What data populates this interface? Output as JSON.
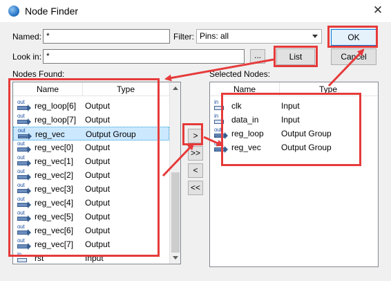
{
  "window": {
    "title": "Node Finder"
  },
  "form": {
    "named_label": "Named:",
    "named_value": "*",
    "filter_label": "Filter:",
    "filter_value": "Pins: all",
    "lookin_label": "Look in:",
    "lookin_value": "*",
    "browse_label": "..."
  },
  "buttons": {
    "ok": "OK",
    "list": "List",
    "cancel": "Cancel",
    "move_one": ">",
    "move_all": ">>",
    "remove_one": "<",
    "remove_all": "<<"
  },
  "nodes_found": {
    "heading": "Nodes Found:",
    "col_name": "Name",
    "col_type": "Type",
    "rows": [
      {
        "io": "out",
        "name": "reg_loop[6]",
        "type": "Output"
      },
      {
        "io": "out",
        "name": "reg_loop[7]",
        "type": "Output"
      },
      {
        "io": "out",
        "name": "reg_vec",
        "type": "Output Group",
        "selected": true
      },
      {
        "io": "out",
        "name": "reg_vec[0]",
        "type": "Output"
      },
      {
        "io": "out",
        "name": "reg_vec[1]",
        "type": "Output"
      },
      {
        "io": "out",
        "name": "reg_vec[2]",
        "type": "Output"
      },
      {
        "io": "out",
        "name": "reg_vec[3]",
        "type": "Output"
      },
      {
        "io": "out",
        "name": "reg_vec[4]",
        "type": "Output"
      },
      {
        "io": "out",
        "name": "reg_vec[5]",
        "type": "Output"
      },
      {
        "io": "out",
        "name": "reg_vec[6]",
        "type": "Output"
      },
      {
        "io": "out",
        "name": "reg_vec[7]",
        "type": "Output"
      },
      {
        "io": "in",
        "name": "rst",
        "type": "Input"
      }
    ]
  },
  "selected_nodes": {
    "heading": "Selected Nodes:",
    "col_name": "Name",
    "col_type": "Type",
    "rows": [
      {
        "io": "in",
        "name": "clk",
        "type": "Input"
      },
      {
        "io": "in",
        "name": "data_in",
        "type": "Input"
      },
      {
        "io": "out",
        "name": "reg_loop",
        "type": "Output Group"
      },
      {
        "io": "out",
        "name": "reg_vec",
        "type": "Output Group"
      }
    ]
  },
  "colors": {
    "annotation_red": "#e63a3a",
    "selection": "#cce8ff"
  }
}
